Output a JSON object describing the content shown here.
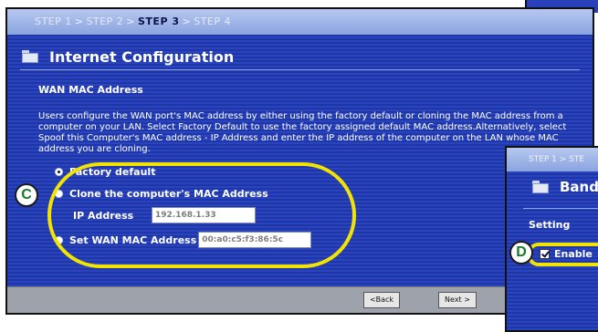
{
  "wizard": {
    "steps": [
      "STEP 1",
      "STEP 2",
      "STEP 3",
      "STEP 4"
    ],
    "active_step_label": "STEP 3",
    "title": "Internet Configuration",
    "section_header": "WAN MAC Address",
    "description": "Users configure the WAN port's MAC address by either using the factory default or cloning the MAC address from a computer on your LAN. Select Factory Default to use the factory assigned default MAC address.Alternatively, select Spoof this Computer's MAC address - IP Address and enter the IP address of the computer on the LAN whose MAC address you are cloning.",
    "options": {
      "factory_default": "Factory default",
      "clone": "Clone the computer's MAC Address",
      "set_wan": "Set WAN MAC Address"
    },
    "ip_label": "IP Address",
    "ip_value": "192.168.1.33",
    "mac_value": "00:a0:c5:f3:86:5c",
    "selected_option": "factory_default",
    "back_label": "<Back",
    "next_label": "Next >"
  },
  "callouts": {
    "c": "C",
    "d": "D"
  },
  "bandwidth_panel": {
    "steps_text": "STEP 1 > STE",
    "title": "Band",
    "setting_label": "Setting",
    "enable_label": "Enable"
  },
  "colors": {
    "panel_blue": "#1f36a8",
    "highlight_yellow": "#f2e400",
    "marker_green": "#157a2a"
  },
  "icons": [
    "folder-icon",
    "radio-icon",
    "checkbox-icon"
  ]
}
